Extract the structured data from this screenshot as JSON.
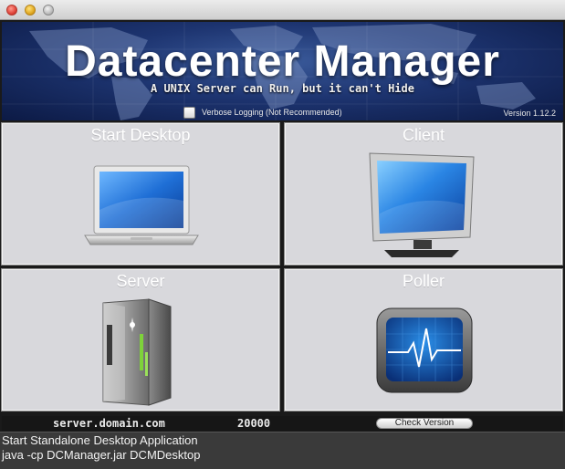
{
  "banner": {
    "title": "Datacenter Manager",
    "subtitle": "A UNIX Server can Run, but it can't Hide",
    "verbose_label": "Verbose Logging (Not Recommended)",
    "version": "Version 1.12.2"
  },
  "tiles": {
    "start_desktop": "Start Desktop",
    "client": "Client",
    "server": "Server",
    "poller": "Poller"
  },
  "statusbar": {
    "host": "server.domain.com",
    "port": "20000",
    "check_version_label": "Check Version"
  },
  "console": {
    "line1": "Start Standalone Desktop Application",
    "line2": "java -cp DCManager.jar DCMDesktop"
  },
  "icons": [
    "laptop-icon",
    "monitor-icon",
    "server-rack-icon",
    "heartbeat-monitor-icon",
    "world-map-icon",
    "checkbox-icon"
  ]
}
